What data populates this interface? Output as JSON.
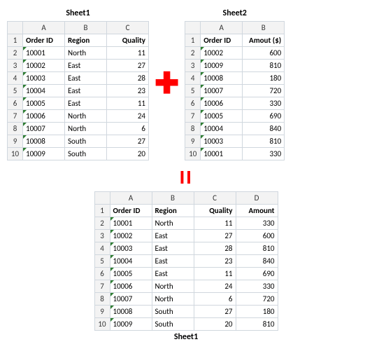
{
  "labels": {
    "sheet1": "Sheet1",
    "sheet2": "Sheet2",
    "sheet1_result": "Sheet1"
  },
  "colLetters": [
    "A",
    "B",
    "C",
    "D"
  ],
  "sheet1": {
    "headers": [
      "Order ID",
      "Region",
      "Quality"
    ],
    "rows": [
      {
        "id": "10001",
        "region": "North",
        "quality": 11
      },
      {
        "id": "10002",
        "region": "East",
        "quality": 27
      },
      {
        "id": "10003",
        "region": "East",
        "quality": 28
      },
      {
        "id": "10004",
        "region": "East",
        "quality": 23
      },
      {
        "id": "10005",
        "region": "East",
        "quality": 11
      },
      {
        "id": "10006",
        "region": "North",
        "quality": 24
      },
      {
        "id": "10007",
        "region": "North",
        "quality": 6
      },
      {
        "id": "10008",
        "region": "South",
        "quality": 27
      },
      {
        "id": "10009",
        "region": "South",
        "quality": 20
      }
    ]
  },
  "sheet2": {
    "headers": [
      "Order ID",
      "Amout ($)"
    ],
    "rows": [
      {
        "id": "10002",
        "amount": 600
      },
      {
        "id": "10009",
        "amount": 810
      },
      {
        "id": "10008",
        "amount": 180
      },
      {
        "id": "10007",
        "amount": 720
      },
      {
        "id": "10006",
        "amount": 330
      },
      {
        "id": "10005",
        "amount": 690
      },
      {
        "id": "10004",
        "amount": 840
      },
      {
        "id": "10003",
        "amount": 810
      },
      {
        "id": "10001",
        "amount": 330
      }
    ]
  },
  "result": {
    "headers": [
      "Order ID",
      "Region",
      "Quality",
      "Amount"
    ],
    "rows": [
      {
        "id": "10001",
        "region": "North",
        "quality": 11,
        "amount": 330
      },
      {
        "id": "10002",
        "region": "East",
        "quality": 27,
        "amount": 600
      },
      {
        "id": "10003",
        "region": "East",
        "quality": 28,
        "amount": 810
      },
      {
        "id": "10004",
        "region": "East",
        "quality": 23,
        "amount": 840
      },
      {
        "id": "10005",
        "region": "East",
        "quality": 11,
        "amount": 690
      },
      {
        "id": "10006",
        "region": "North",
        "quality": 24,
        "amount": 330
      },
      {
        "id": "10007",
        "region": "North",
        "quality": 6,
        "amount": 720
      },
      {
        "id": "10008",
        "region": "South",
        "quality": 27,
        "amount": 180
      },
      {
        "id": "10009",
        "region": "South",
        "quality": 20,
        "amount": 810
      }
    ]
  }
}
